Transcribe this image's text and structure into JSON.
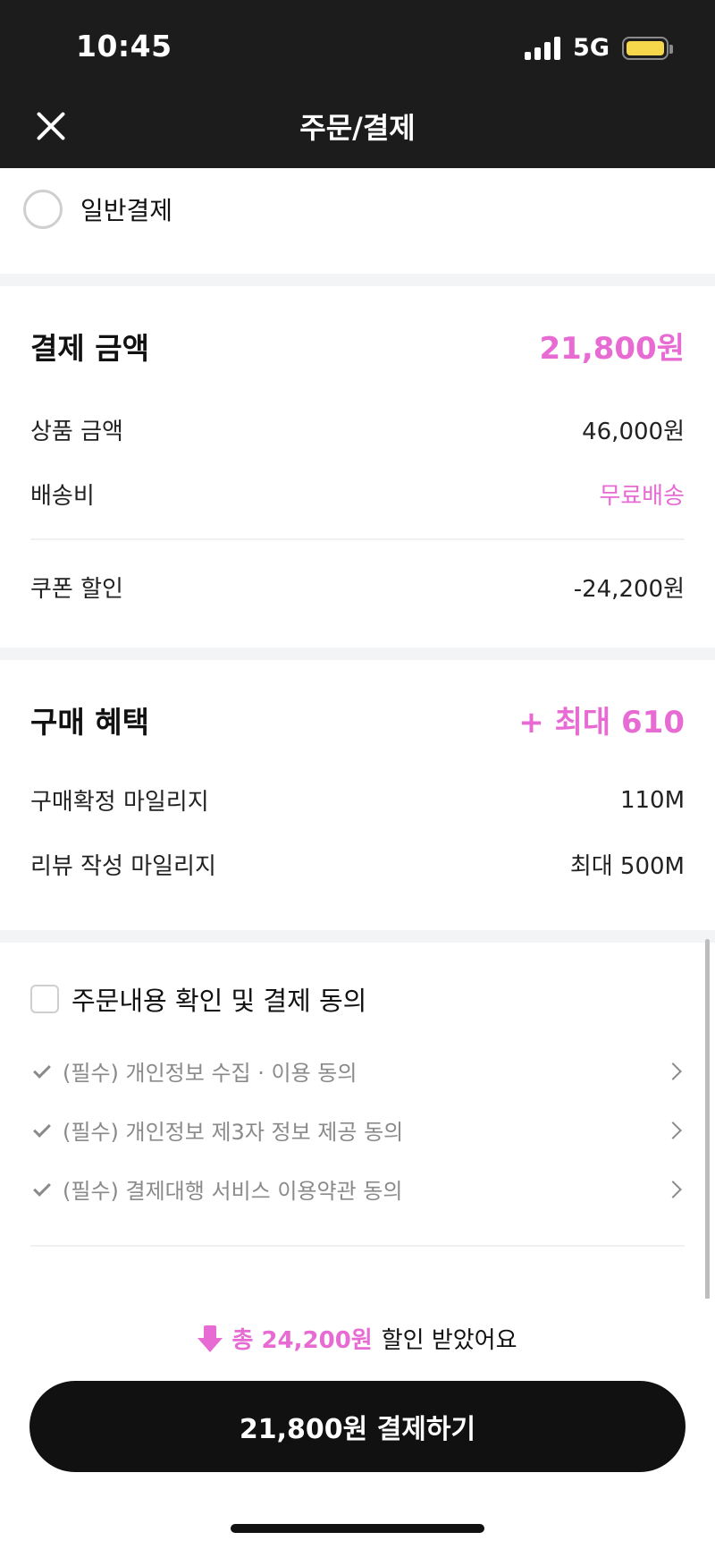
{
  "status_bar": {
    "time": "10:45",
    "network": "5G"
  },
  "nav": {
    "title": "주문/결제"
  },
  "payment_method": {
    "label": "일반결제"
  },
  "payment_amount": {
    "title": "결제 금액",
    "total": "21,800원",
    "rows": [
      {
        "label": "상품 금액",
        "value": "46,000원"
      },
      {
        "label": "배송비",
        "value": "무료배송"
      },
      {
        "label": "쿠폰 할인",
        "value": "-24,200원"
      }
    ]
  },
  "benefits": {
    "title": "구매 혜택",
    "total": "+ 최대 610",
    "rows": [
      {
        "label": "구매확정 마일리지",
        "value": "110M"
      },
      {
        "label": "리뷰 작성 마일리지",
        "value": "최대 500M"
      }
    ]
  },
  "agreement": {
    "label": "주문내용 확인 및 결제 동의",
    "terms": [
      "(필수) 개인정보 수집 · 이용 동의",
      "(필수) 개인정보 제3자 정보 제공 동의",
      "(필수) 결제대행 서비스 이용약관 동의"
    ]
  },
  "bottom": {
    "discount_prefix": "총 24,200원",
    "discount_suffix": "할인 받았어요",
    "pay_button": "21,800원 결제하기"
  },
  "colors": {
    "accent": "#e76bd3",
    "header_bg": "#1c1c1c",
    "button_bg": "#111111"
  }
}
